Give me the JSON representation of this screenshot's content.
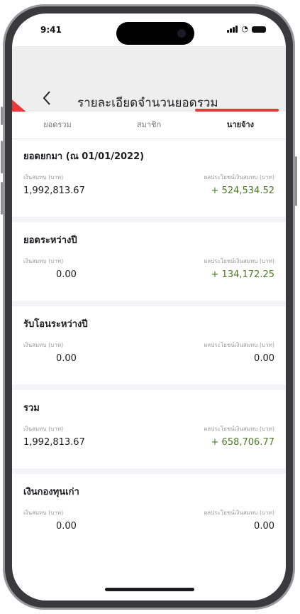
{
  "status_bar": {
    "time": "9:41"
  },
  "header": {
    "title": "รายละเอียดจำนวนยอดรวม"
  },
  "tabs": [
    {
      "label": "ยอดรวม",
      "active": false
    },
    {
      "label": "สมาชิก",
      "active": false
    },
    {
      "label": "นายจ้าง",
      "active": true
    }
  ],
  "sections": [
    {
      "title": "ยอดยกมา (ณ 01/01/2022)",
      "left_label": "เงินสมทบ (บาท)",
      "left_value": "1,992,813.67",
      "right_label": "ผลประโยชน์เงินสมทบ (บาท)",
      "right_value": "+ 524,534.52"
    },
    {
      "title": "ยอดระหว่างปี",
      "left_label": "เงินสมทบ (บาท)",
      "left_value": "0.00",
      "right_label": "ผลประโยชน์เงินสมทบ (บาท)",
      "right_value": "+ 134,172.25"
    },
    {
      "title": "รับโอนระหว่างปี",
      "left_label": "เงินสมทบ (บาท)",
      "left_value": "0.00",
      "right_label": "ผลประโยชน์เงินสมทบ (บาท)",
      "right_value": "0.00"
    },
    {
      "title": "รวม",
      "left_label": "เงินสมทบ (บาท)",
      "left_value": "1,992,813.67",
      "right_label": "ผลประโยชน์เงินสมทบ (บาท)",
      "right_value": "+ 658,706.77"
    },
    {
      "title": "เงินกองทุนเก่า",
      "left_label": "เงินสมทบ (บาท)",
      "left_value": "0.00",
      "right_label": "ผลประโยชน์เงินสมทบ (บาท)",
      "right_value": "0.00"
    }
  ],
  "colors": {
    "accent": "#e53935",
    "positive": "#4c7a25",
    "header_bg": "#eeeeef"
  },
  "icons": [
    "back-chevron-icon",
    "signal-icon",
    "wifi-icon",
    "battery-icon",
    "brand-logo"
  ]
}
